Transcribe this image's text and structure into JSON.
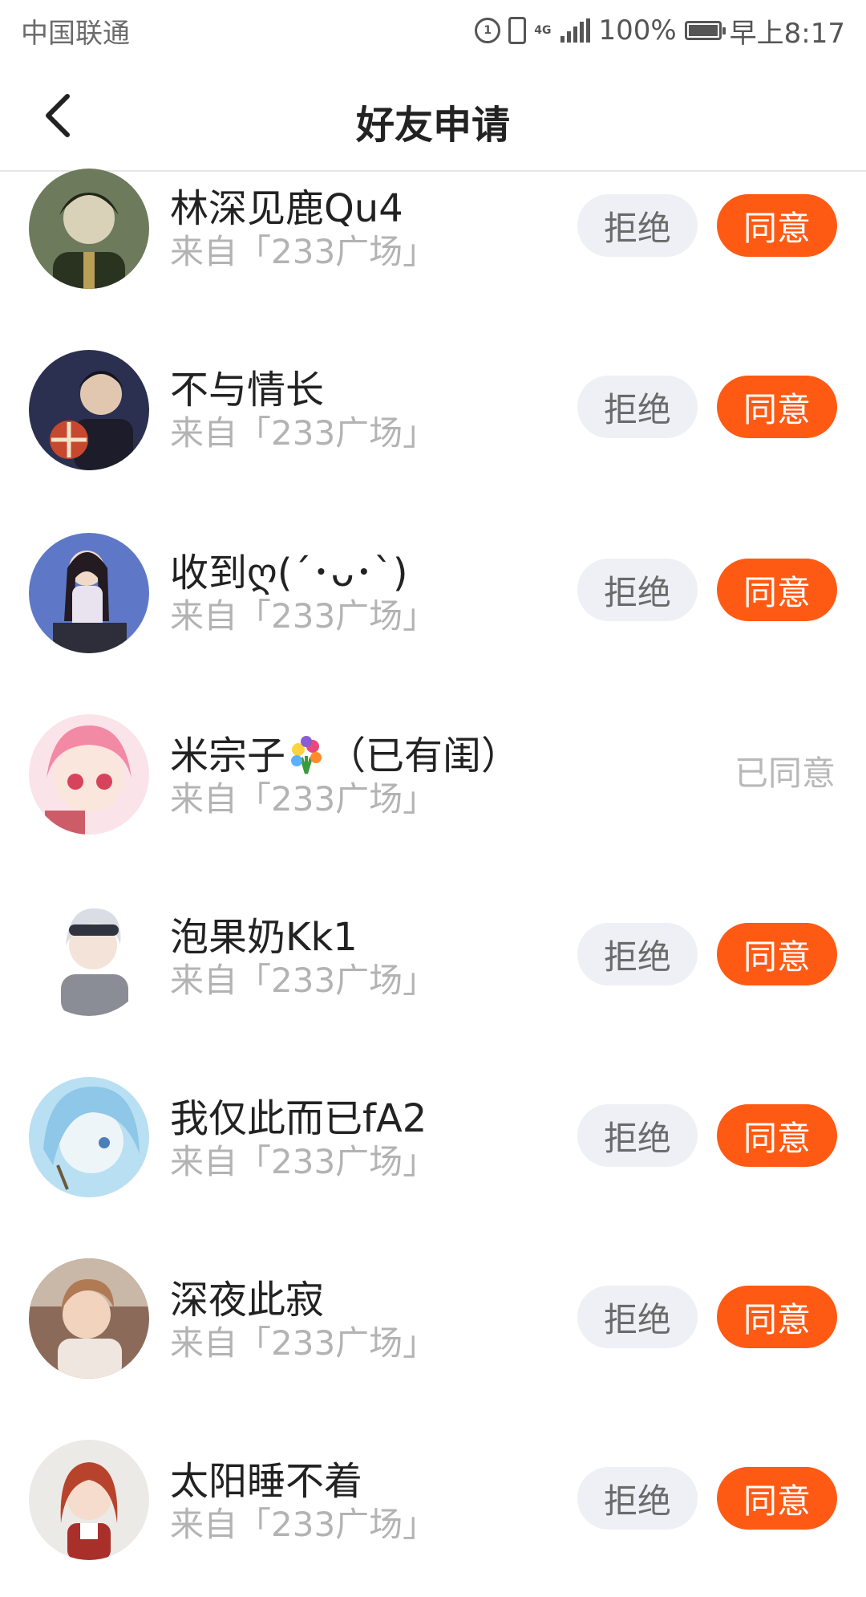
{
  "status_bar": {
    "carrier": "中国联通",
    "network": "4G",
    "battery": "100%",
    "time": "早上8:17",
    "battery_level": 1.0
  },
  "header": {
    "title": "好友申请",
    "back_icon": "chevron-left-icon"
  },
  "labels": {
    "reject": "拒绝",
    "accept": "同意",
    "accepted": "已同意"
  },
  "requests": [
    {
      "name": "林深见鹿Qu4",
      "source": "来自「233广场」",
      "state": "pending"
    },
    {
      "name": "不与情长",
      "source": "来自「233广场」",
      "state": "pending"
    },
    {
      "name": "收到ღ(´･ᴗ･`)",
      "source": "来自「233广场」",
      "state": "pending"
    },
    {
      "name_prefix": "米宗子",
      "name_suffix": "（已有闺）",
      "name_emoji": "bouquet-emoji",
      "source": "来自「233广场」",
      "state": "accepted"
    },
    {
      "name": "泡果奶Kk1",
      "source": "来自「233广场」",
      "state": "pending"
    },
    {
      "name": "我仅此而已fA2",
      "source": "来自「233广场」",
      "state": "pending"
    },
    {
      "name": "深夜此寂",
      "source": "来自「233广场」",
      "state": "pending"
    },
    {
      "name": "太阳睡不着",
      "source": "来自「233广场」",
      "state": "pending"
    }
  ],
  "colors": {
    "accent": "#ff5a14",
    "reject_bg": "#eef0f5",
    "source_text": "#b3b3b3"
  }
}
